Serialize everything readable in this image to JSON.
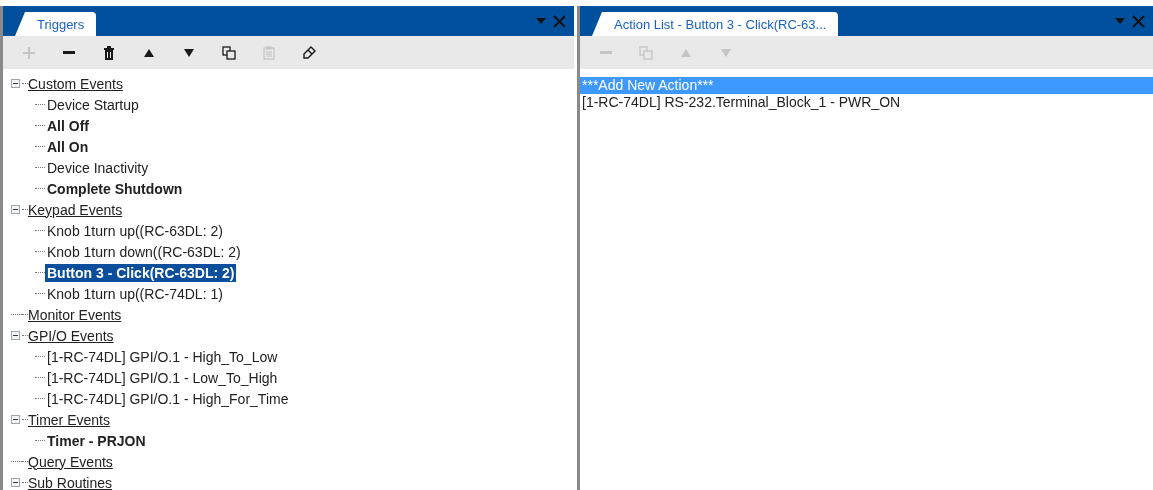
{
  "panels": [
    {
      "tab": {
        "label": "Triggers",
        "selected": true
      },
      "toolbar": [
        {
          "kind": "add",
          "disabled": true
        },
        {
          "kind": "remove",
          "disabled": false
        },
        {
          "kind": "delete",
          "disabled": false
        },
        {
          "kind": "up",
          "disabled": false
        },
        {
          "kind": "down",
          "disabled": false
        },
        {
          "kind": "copy",
          "disabled": false
        },
        {
          "kind": "paste",
          "disabled": true
        },
        {
          "kind": "edit",
          "disabled": false
        }
      ],
      "tree": [
        {
          "label": "Custom Events",
          "expanded": true,
          "children": [
            {
              "label": "Device Startup",
              "bold": false,
              "selected": false
            },
            {
              "label": "All Off",
              "bold": true,
              "selected": false
            },
            {
              "label": "All On",
              "bold": true,
              "selected": false
            },
            {
              "label": "Device Inactivity",
              "bold": false,
              "selected": false
            },
            {
              "label": "Complete Shutdown",
              "bold": true,
              "selected": false
            }
          ]
        },
        {
          "label": "Keypad Events",
          "expanded": true,
          "children": [
            {
              "label": "Knob 1turn up((RC-63DL: 2)",
              "bold": false,
              "selected": false
            },
            {
              "label": "Knob 1turn down((RC-63DL: 2)",
              "bold": false,
              "selected": false
            },
            {
              "label": "Button 3 - Click(RC-63DL: 2)",
              "bold": true,
              "selected": true
            },
            {
              "label": "Knob 1turn up((RC-74DL: 1)",
              "bold": false,
              "selected": false
            }
          ]
        },
        {
          "label": "Monitor Events",
          "expanded": false
        },
        {
          "label": "GPI/O Events",
          "expanded": true,
          "children": [
            {
              "label": "[1-RC-74DL] GPI/O.1 - High_To_Low",
              "bold": false,
              "selected": false
            },
            {
              "label": "[1-RC-74DL] GPI/O.1 - Low_To_High",
              "bold": false,
              "selected": false
            },
            {
              "label": "[1-RC-74DL] GPI/O.1 - High_For_Time",
              "bold": false,
              "selected": false
            }
          ]
        },
        {
          "label": "Timer Events",
          "expanded": true,
          "children": [
            {
              "label": "Timer - PRJON",
              "bold": true,
              "selected": false
            }
          ]
        },
        {
          "label": "Query Events",
          "expanded": false
        },
        {
          "label": "Sub Routines",
          "expanded": true
        }
      ]
    },
    {
      "tab": {
        "label": "Action List - Button 3 - Click(RC-63...",
        "selected": true
      },
      "toolbar": [
        {
          "kind": "remove",
          "disabled": true
        },
        {
          "kind": "copy",
          "disabled": true
        },
        {
          "kind": "up",
          "disabled": true
        },
        {
          "kind": "down",
          "disabled": true
        }
      ],
      "list": [
        {
          "label": "***Add New Action***",
          "selected": true
        },
        {
          "label": "[1-RC-74DL] RS-232.Terminal_Block_1 - PWR_ON",
          "selected": false
        }
      ]
    }
  ]
}
